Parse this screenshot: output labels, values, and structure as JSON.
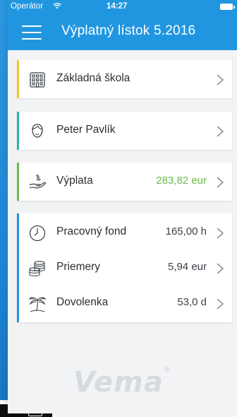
{
  "status_bar": {
    "carrier": "Operátor",
    "time": "14:27"
  },
  "navbar": {
    "title": "Výplatný lístok 5.2016"
  },
  "cards": {
    "school": {
      "label": "Základná škola",
      "icon": "building-icon",
      "accent": "#f3c520"
    },
    "employee": {
      "label": "Peter Pavlík",
      "icon": "person-face-icon",
      "accent": "#2ab3a5"
    },
    "payout": {
      "label": "Výplata",
      "value": "283,82 eur",
      "icon": "hand-money-icon",
      "accent": "#6abc4c",
      "value_color": "#6abc4c"
    },
    "details": {
      "accent": "#2196e0",
      "rows": [
        {
          "label": "Pracovný fond",
          "value": "165,00 h",
          "icon": "clock-icon"
        },
        {
          "label": "Priemery",
          "value": "5,94 eur",
          "icon": "coins-stack-icon"
        },
        {
          "label": "Dovolenka",
          "value": "53,0 d",
          "icon": "palm-tree-icon"
        }
      ]
    }
  },
  "footer": {
    "logo_text": "Vema",
    "logo_mark": "®"
  },
  "colors": {
    "primary": "#2196e0",
    "background": "#f2f3f5",
    "text": "#2a2f33"
  }
}
